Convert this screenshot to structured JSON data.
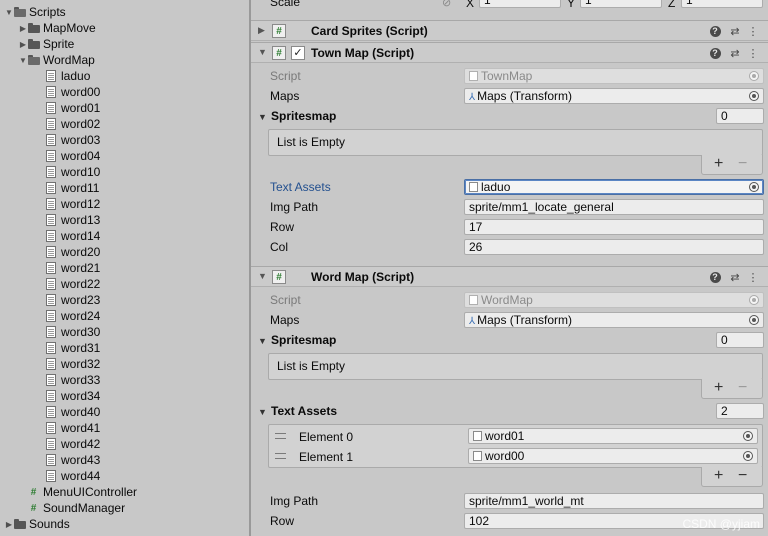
{
  "tree": {
    "items": [
      {
        "label": "Scripts",
        "kind": "folder",
        "indent": 0,
        "arrow": "down"
      },
      {
        "label": "MapMove",
        "kind": "folder",
        "indent": 1,
        "arrow": "right"
      },
      {
        "label": "Sprite",
        "kind": "folder",
        "indent": 1,
        "arrow": "right"
      },
      {
        "label": "WordMap",
        "kind": "folder",
        "indent": 1,
        "arrow": "down"
      },
      {
        "label": "laduo",
        "kind": "text",
        "indent": 2
      },
      {
        "label": "word00",
        "kind": "text",
        "indent": 2
      },
      {
        "label": "word01",
        "kind": "text",
        "indent": 2
      },
      {
        "label": "word02",
        "kind": "text",
        "indent": 2
      },
      {
        "label": "word03",
        "kind": "text",
        "indent": 2
      },
      {
        "label": "word04",
        "kind": "text",
        "indent": 2
      },
      {
        "label": "word10",
        "kind": "text",
        "indent": 2
      },
      {
        "label": "word11",
        "kind": "text",
        "indent": 2
      },
      {
        "label": "word12",
        "kind": "text",
        "indent": 2
      },
      {
        "label": "word13",
        "kind": "text",
        "indent": 2
      },
      {
        "label": "word14",
        "kind": "text",
        "indent": 2
      },
      {
        "label": "word20",
        "kind": "text",
        "indent": 2
      },
      {
        "label": "word21",
        "kind": "text",
        "indent": 2
      },
      {
        "label": "word22",
        "kind": "text",
        "indent": 2
      },
      {
        "label": "word23",
        "kind": "text",
        "indent": 2
      },
      {
        "label": "word24",
        "kind": "text",
        "indent": 2
      },
      {
        "label": "word30",
        "kind": "text",
        "indent": 2
      },
      {
        "label": "word31",
        "kind": "text",
        "indent": 2
      },
      {
        "label": "word32",
        "kind": "text",
        "indent": 2
      },
      {
        "label": "word33",
        "kind": "text",
        "indent": 2
      },
      {
        "label": "word34",
        "kind": "text",
        "indent": 2
      },
      {
        "label": "word40",
        "kind": "text",
        "indent": 2
      },
      {
        "label": "word41",
        "kind": "text",
        "indent": 2
      },
      {
        "label": "word42",
        "kind": "text",
        "indent": 2
      },
      {
        "label": "word43",
        "kind": "text",
        "indent": 2
      },
      {
        "label": "word44",
        "kind": "text",
        "indent": 2
      },
      {
        "label": "MenuUIController",
        "kind": "script",
        "indent": 1
      },
      {
        "label": "SoundManager",
        "kind": "script",
        "indent": 1
      },
      {
        "label": "Sounds",
        "kind": "folder",
        "indent": 0,
        "arrow": "right"
      }
    ]
  },
  "transform_row": {
    "label": "Scale",
    "x_label": "X",
    "x_value": "1",
    "y_label": "Y",
    "y_value": "1",
    "z_label": "Z",
    "z_value": "1"
  },
  "card_sprites": {
    "title": "Card Sprites (Script)"
  },
  "town_map": {
    "title": "Town Map (Script)",
    "script_label": "Script",
    "script_value": "TownMap",
    "maps_label": "Maps",
    "maps_value": "Maps (Transform)",
    "spritesmap_label": "Spritesmap",
    "spritesmap_count": "0",
    "list_empty": "List is Empty",
    "text_assets_label": "Text Assets",
    "text_assets_value": "laduo",
    "img_path_label": "Img Path",
    "img_path_value": "sprite/mm1_locate_general",
    "row_label": "Row",
    "row_value": "17",
    "col_label": "Col",
    "col_value": "26"
  },
  "word_map": {
    "title": "Word Map (Script)",
    "script_label": "Script",
    "script_value": "WordMap",
    "maps_label": "Maps",
    "maps_value": "Maps (Transform)",
    "spritesmap_label": "Spritesmap",
    "spritesmap_count": "0",
    "list_empty": "List is Empty",
    "text_assets_label": "Text Assets",
    "text_assets_count": "2",
    "elements": [
      {
        "label": "Element 0",
        "value": "word01"
      },
      {
        "label": "Element 1",
        "value": "word00"
      }
    ],
    "img_path_label": "Img Path",
    "img_path_value": "sprite/mm1_world_mt",
    "row_label": "Row",
    "row_value": "102"
  },
  "list_controls": {
    "plus": "+",
    "minus": "−"
  },
  "watermark": "CSDN @yjiam",
  "icons": {
    "help": "help-icon",
    "settings": "preset-sliders-icon",
    "more": "more-vertical-icon"
  }
}
